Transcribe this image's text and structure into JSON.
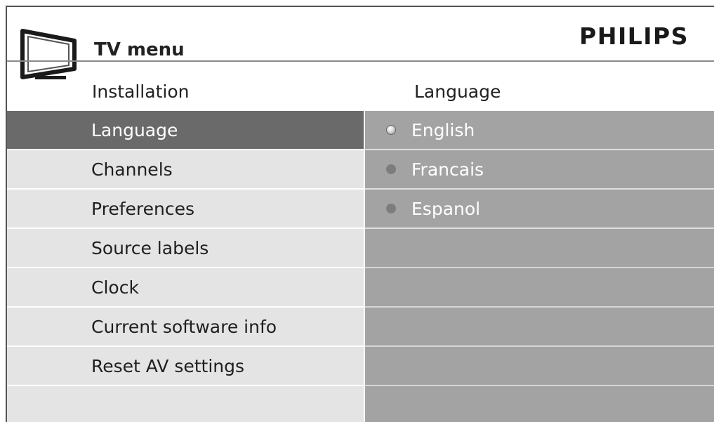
{
  "header": {
    "title": "TV menu",
    "brand": "PHILIPS"
  },
  "left_panel": {
    "heading": "Installation",
    "items": [
      {
        "label": "Language",
        "selected": true
      },
      {
        "label": "Channels",
        "selected": false
      },
      {
        "label": "Preferences",
        "selected": false
      },
      {
        "label": "Source labels",
        "selected": false
      },
      {
        "label": "Clock",
        "selected": false
      },
      {
        "label": "Current software info",
        "selected": false
      },
      {
        "label": "Reset AV settings",
        "selected": false
      }
    ]
  },
  "right_panel": {
    "heading": "Language",
    "options": [
      {
        "label": "English",
        "selected": true
      },
      {
        "label": "Francais",
        "selected": false
      },
      {
        "label": "Espanol",
        "selected": false
      }
    ]
  },
  "colors": {
    "selected_row": "#6a6a6a",
    "row_background": "#e4e4e4",
    "options_background": "#a3a3a3"
  },
  "icons": {
    "tv": "tv-icon",
    "radio_selected": "radio-selected-icon",
    "radio_unselected": "radio-unselected-icon"
  }
}
